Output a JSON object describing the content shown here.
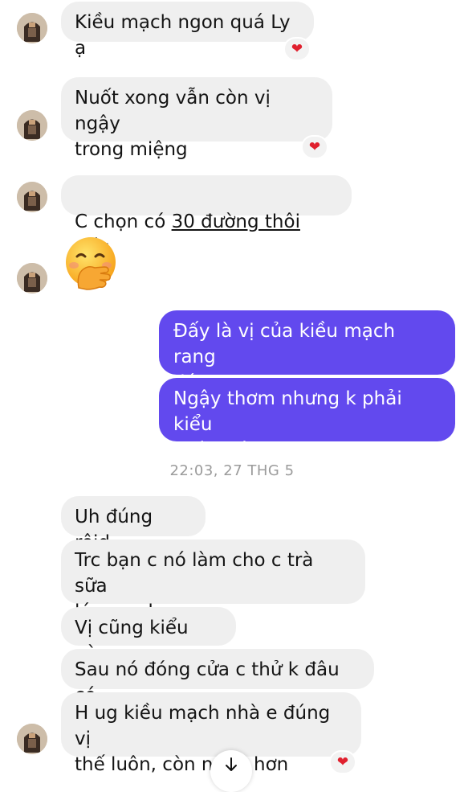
{
  "messages": {
    "m1": "Kiều mạch ngon quá Ly ạ",
    "m2": "Nuốt xong vẫn còn vị ngậy\ntrong miệng",
    "m3_prefix": "C chọn có ",
    "m3_link": "30 đường thôi",
    "m3_suffix": " đấy",
    "m5": "Đấy là vị của kiều mạch rang\nđó ạ",
    "m6": "Ngậy thơm nhưng k phải kiểu\nngậy béo sữa",
    "m7": "Uh đúng rôid",
    "m8": "Trc bạn c nó làm cho c trà sữa\nlúa mạch",
    "m9": "Vị cũng kiểu này",
    "m10": "Sau nó đóng cửa c thử k đâu có",
    "m11": "H ug kiều mạch nhà e đúng vị\nthế luôn, còn ngon hơn"
  },
  "timestamp": "22:03, 27 THG 5",
  "reactions": {
    "m1": "❤",
    "m2": "❤",
    "m11": "❤"
  },
  "icons": {
    "avatar": "avatar-icon",
    "emoji": "face-with-hand-over-mouth-emoji",
    "reaction": "heart-icon",
    "scroll": "arrow-down-icon"
  },
  "colors": {
    "incoming_bubble": "#efefef",
    "outgoing_bubble": "#6249ee",
    "heart": "#e0202e",
    "timestamp": "#9b9b9b"
  }
}
